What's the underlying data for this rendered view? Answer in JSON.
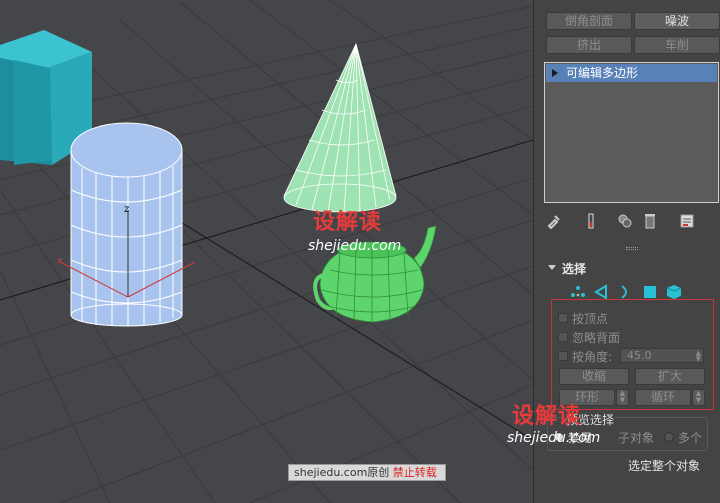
{
  "modifiers": {
    "bevel_profile": "倒角剖面",
    "noise": "噪波",
    "extrude": "挤出",
    "lathe": "车削"
  },
  "stack": {
    "item": "可编辑多边形"
  },
  "selection": {
    "rollout_title": "选择",
    "by_vertex": "按顶点",
    "ignore_backfacing": "忽略背面",
    "by_angle": "按角度:",
    "angle_value": "45.0",
    "shrink": "收缩",
    "grow": "扩大",
    "ring": "环形",
    "loop": "循环",
    "preview_title": "预览选择",
    "off": "禁用",
    "subobject": "子对象",
    "multi": "多个",
    "whole_object": "选定整个对象"
  },
  "watermark": {
    "logo": "设解读",
    "url": "shejiedu.com",
    "bar_site": "shejiedu.com原创",
    "bar_note": "禁止转载"
  },
  "viewport": {
    "axis_label": "z",
    "axis_x_label": "x"
  },
  "colors": {
    "box": "#2aa9b9",
    "cylinder": "#a9c3ef",
    "cone": "#9fe3b2",
    "teapot": "#5ed46c",
    "stack_highlight": "#5881b8",
    "red_frame": "#c9343a"
  }
}
